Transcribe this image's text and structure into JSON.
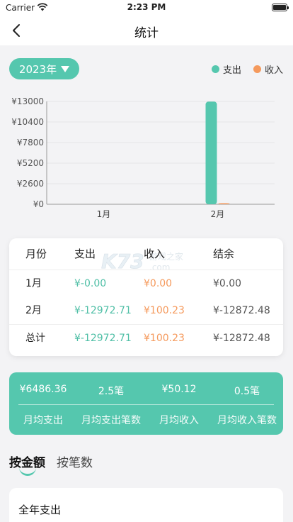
{
  "status_bar": {
    "carrier": "Carrier",
    "time": "2:23 PM"
  },
  "nav": {
    "title": "统计"
  },
  "year_selector": {
    "value": "2023年"
  },
  "legend": {
    "expense": "支出",
    "income": "收入"
  },
  "colors": {
    "expense": "#55c7ae",
    "income": "#f59a5d",
    "accent": "#55c7ae"
  },
  "chart_data": {
    "type": "bar",
    "categories": [
      "1月",
      "2月"
    ],
    "series": [
      {
        "name": "支出",
        "values": [
          0,
          12972.71
        ]
      },
      {
        "name": "收入",
        "values": [
          0,
          100.23
        ]
      }
    ],
    "yticks": [
      "¥13000",
      "¥10400",
      "¥7800",
      "¥5200",
      "¥2600",
      "¥0"
    ],
    "ytick_values": [
      13000,
      10400,
      7800,
      5200,
      2600,
      0
    ],
    "ylim": [
      0,
      13000
    ],
    "grid": true
  },
  "table": {
    "headers": [
      "月份",
      "支出",
      "收入",
      "结余"
    ],
    "rows": [
      {
        "month": "1月",
        "expense": "¥-0.00",
        "income": "¥0.00",
        "balance": "¥0.00"
      },
      {
        "month": "2月",
        "expense": "¥-12972.71",
        "income": "¥100.23",
        "balance": "¥-12872.48"
      },
      {
        "month": "总计",
        "expense": "¥-12972.71",
        "income": "¥100.23",
        "balance": "¥-12872.48"
      }
    ]
  },
  "stats": [
    {
      "value": "¥6486.36",
      "label": "月均支出"
    },
    {
      "value": "2.5笔",
      "label": "月均支出笔数"
    },
    {
      "value": "¥50.12",
      "label": "月均收入"
    },
    {
      "value": "0.5笔",
      "label": "月均收入笔数"
    }
  ],
  "tabs": {
    "amount": "按金额",
    "count": "按笔数"
  },
  "year_card": {
    "title": "全年支出"
  }
}
